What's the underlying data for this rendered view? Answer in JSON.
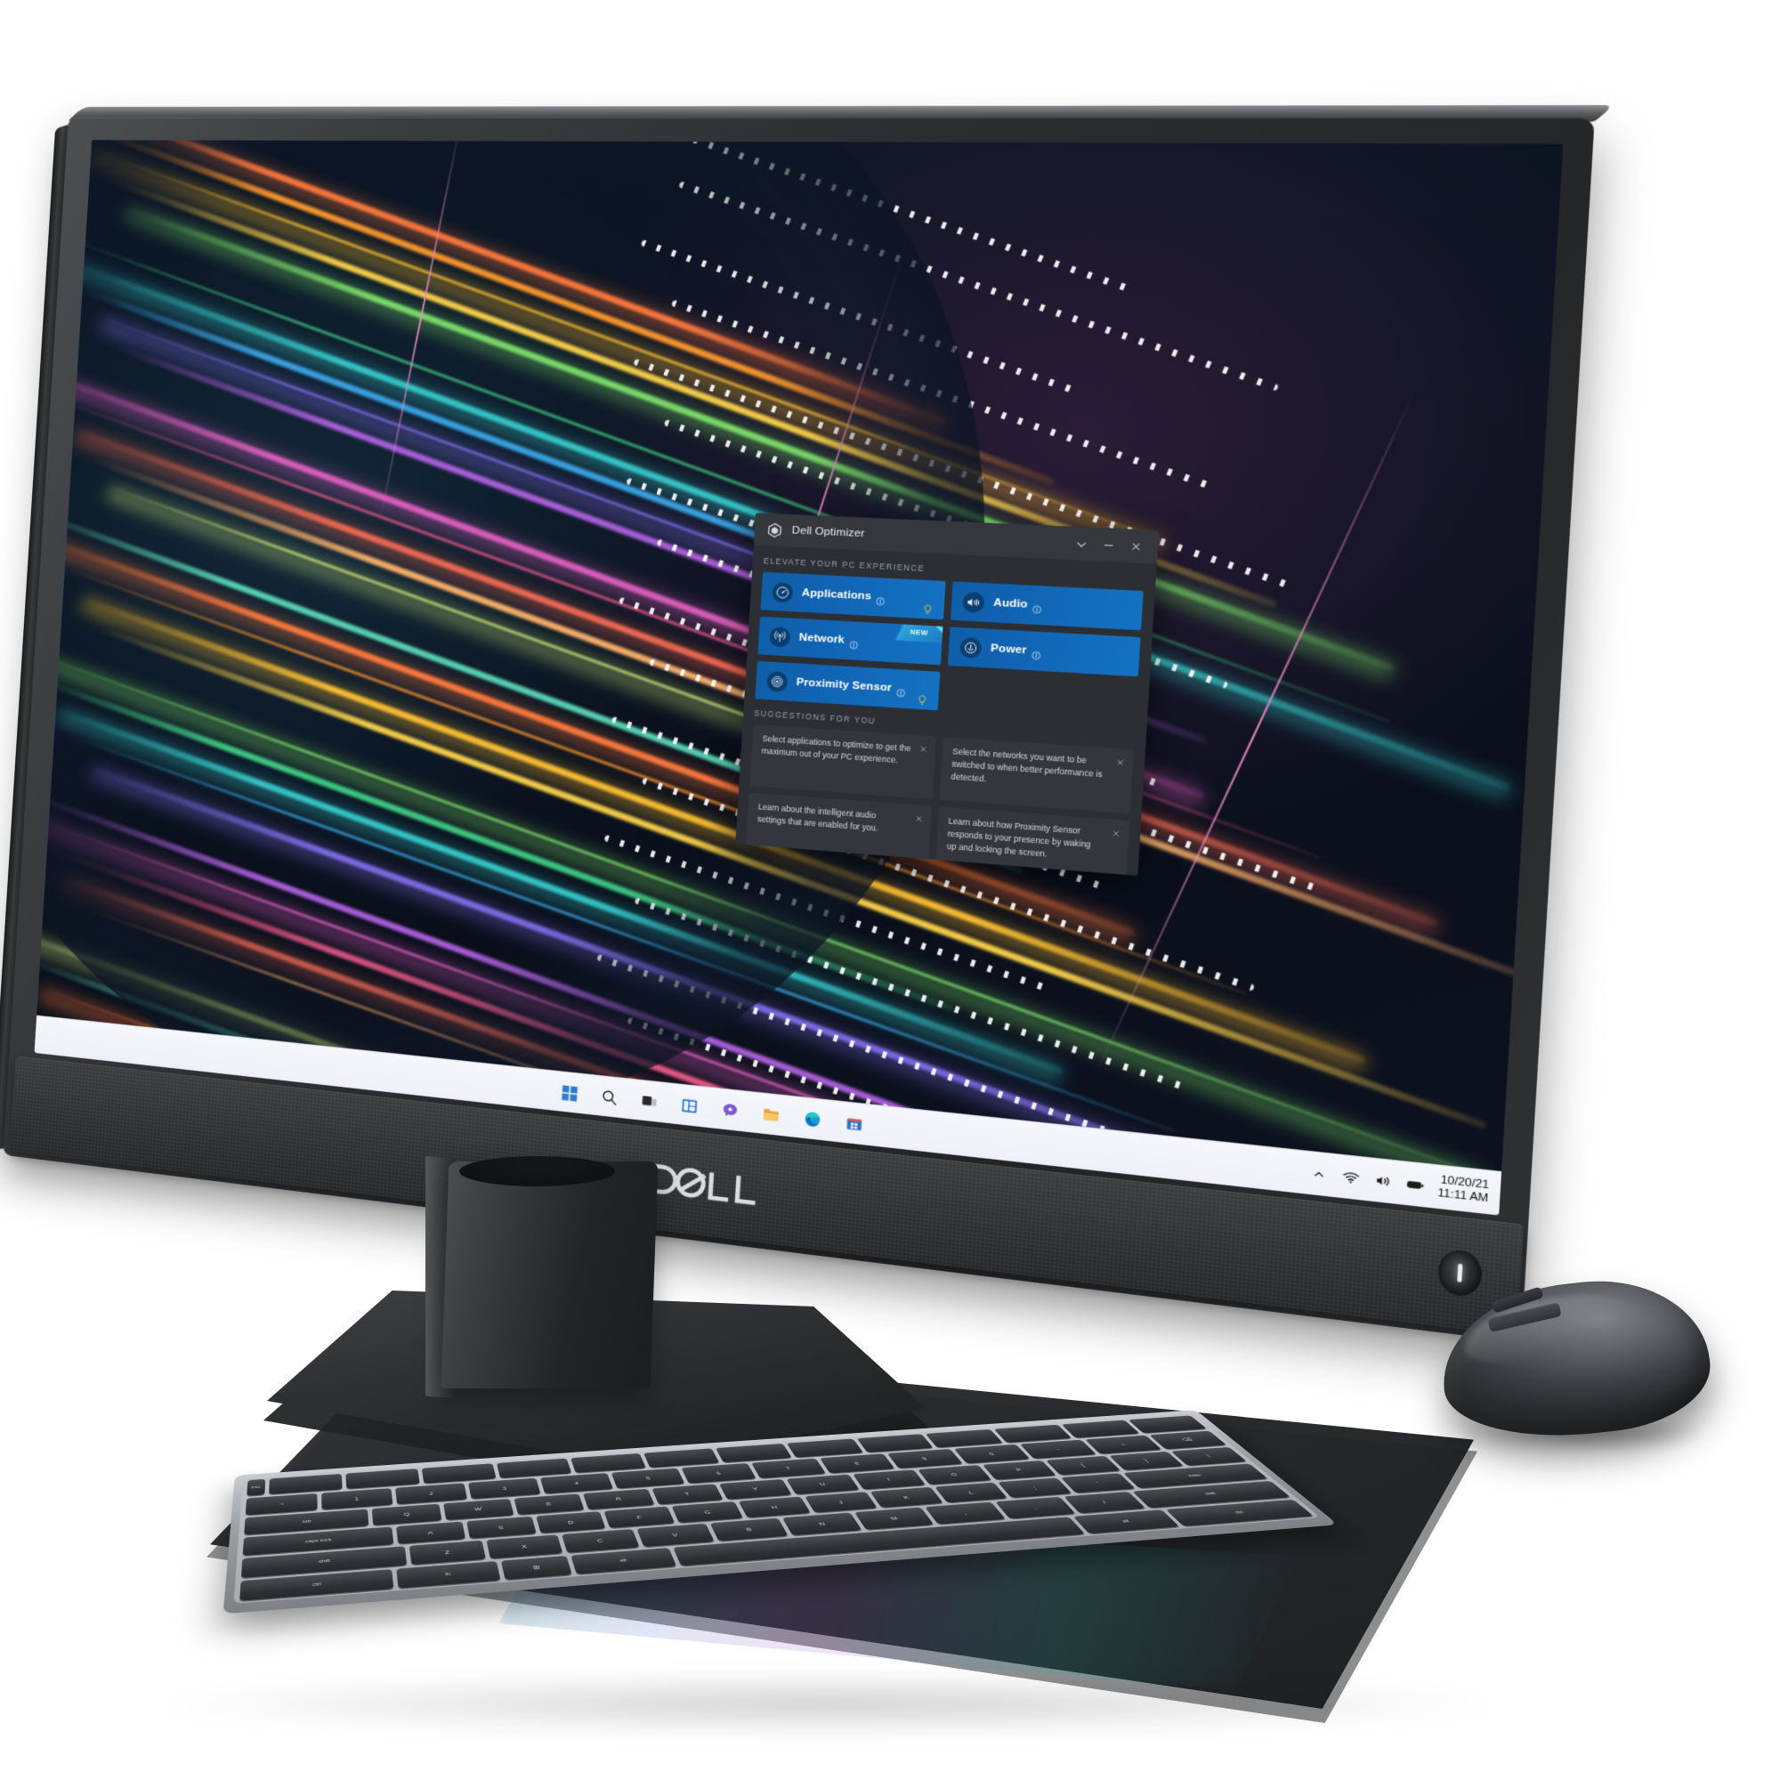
{
  "product": {
    "brand_logo_text": "DELL",
    "power_button_name": "power-button"
  },
  "app": {
    "title": "Dell Optimizer",
    "logo_icon": "dell-optimizer-cube-icon",
    "window_controls": {
      "collapse_label": "⌄",
      "minimize_label": "–",
      "close_label": "×"
    },
    "sections": {
      "features_heading": "ELEVATE YOUR PC EXPERIENCE",
      "suggestions_heading": "SUGGESTIONS FOR YOU"
    },
    "tiles": [
      {
        "label": "Applications",
        "icon": "gauge-icon",
        "badge": "",
        "has_bulb": true,
        "info": "ⓘ"
      },
      {
        "label": "Audio",
        "icon": "sound-wave-icon",
        "badge": "",
        "has_bulb": false,
        "info": "ⓘ"
      },
      {
        "label": "Network",
        "icon": "antenna-signal-icon",
        "badge": "NEW",
        "has_bulb": false,
        "info": "ⓘ"
      },
      {
        "label": "Power",
        "icon": "power-plug-icon",
        "badge": "",
        "has_bulb": false,
        "info": "ⓘ"
      },
      {
        "label": "Proximity Sensor",
        "icon": "radar-target-icon",
        "badge": "",
        "has_bulb": true,
        "info": "ⓘ"
      }
    ],
    "suggestions": [
      {
        "text": "Select applications to optimize to get the maximum out of your PC experience.",
        "dismiss": "×"
      },
      {
        "text": "Select the networks you want to be switched to when better performance is detected.",
        "dismiss": "×"
      },
      {
        "text": "Learn about the intelligent audio settings that are enabled for you.",
        "dismiss": "×"
      },
      {
        "text": "Learn about how Proximity Sensor responds to your presence by waking up and locking the screen.",
        "dismiss": "×"
      }
    ],
    "colors": {
      "tile_blue": "#1164b4",
      "window_bg": "#2b2e33",
      "titlebar_bg": "#34373c",
      "suggestion_bg": "#33373d",
      "bulb_yellow": "#e8c24a",
      "new_badge": "#2fa8e0"
    }
  },
  "taskbar": {
    "icons": [
      {
        "name": "windows-start-icon",
        "label": "Start"
      },
      {
        "name": "search-icon",
        "label": "Search"
      },
      {
        "name": "task-view-icon",
        "label": "Task View"
      },
      {
        "name": "widgets-icon",
        "label": "Widgets"
      },
      {
        "name": "chat-teams-icon",
        "label": "Chat"
      },
      {
        "name": "file-explorer-icon",
        "label": "File Explorer"
      },
      {
        "name": "microsoft-edge-icon",
        "label": "Microsoft Edge"
      },
      {
        "name": "microsoft-store-icon",
        "label": "Microsoft Store"
      }
    ],
    "tray": {
      "show_hidden_label": "⌃",
      "wifi_icon": "wifi-icon",
      "volume_icon": "speaker-icon",
      "battery_icon": "battery-icon",
      "date": "10/20/21",
      "time": "11:11 AM"
    }
  },
  "keyboard": {
    "rows": [
      [
        "esc",
        "",
        "",
        "",
        "",
        "",
        "",
        "",
        "",
        "",
        "",
        "",
        "",
        ""
      ],
      [
        "~",
        "1",
        "2",
        "3",
        "4",
        "5",
        "6",
        "7",
        "8",
        "9",
        "0",
        "-",
        "=",
        "⌫"
      ],
      [
        "tab",
        "Q",
        "W",
        "E",
        "R",
        "T",
        "Y",
        "U",
        "I",
        "O",
        "P",
        "[",
        "]",
        "\\"
      ],
      [
        "caps lock",
        "A",
        "S",
        "D",
        "F",
        "G",
        "H",
        "J",
        "K",
        "L",
        ";",
        "'",
        "enter"
      ],
      [
        "shift",
        "Z",
        "X",
        "C",
        "V",
        "B",
        "N",
        "M",
        ",",
        ".",
        "/",
        "shift"
      ],
      [
        "ctrl",
        "fn",
        "⊞",
        "alt",
        "",
        "alt",
        "ctrl"
      ]
    ]
  },
  "peripherals": {
    "mouse_name": "wireless-mouse",
    "keyboard_name": "wireless-keyboard",
    "mat_name": "desk-mat"
  }
}
